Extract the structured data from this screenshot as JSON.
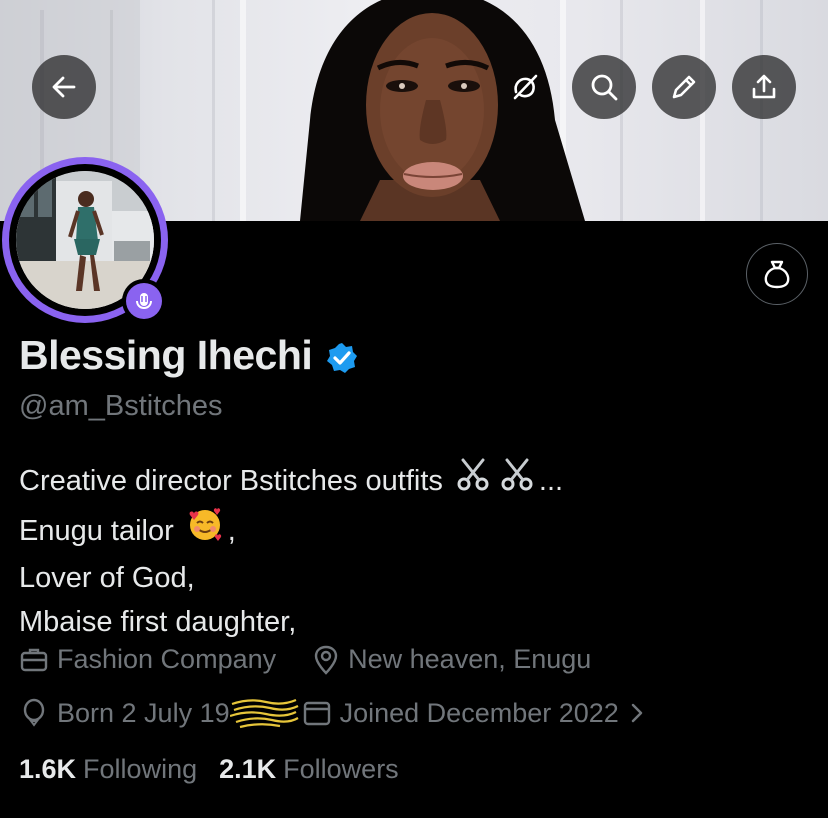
{
  "header": {
    "back_icon": "arrow-left-icon",
    "grok_icon": "grok-icon",
    "search_icon": "search-icon",
    "edit_icon": "pencil-icon",
    "share_icon": "share-icon"
  },
  "profile": {
    "display_name": "Blessing Ihechi",
    "verified": true,
    "handle": "@am_Bstitches",
    "bio_lines": [
      "Creative director Bstitches outfits",
      "...",
      "Enugu tailor",
      ",",
      "Lover of God,",
      "Mbaise first daughter,"
    ],
    "category": "Fashion Company",
    "location": "New heaven, Enugu",
    "birthday": "Born 2 July 19",
    "joined": "Joined December 2022",
    "following_count": "1.6K",
    "following_label": "Following",
    "followers_count": "2.1K",
    "followers_label": "Followers"
  },
  "colors": {
    "background": "#000000",
    "text_primary": "#e7e9ea",
    "text_secondary": "#71767b",
    "spaces_ring": "#8a63f0",
    "verified_badge": "#1d9bf0"
  }
}
